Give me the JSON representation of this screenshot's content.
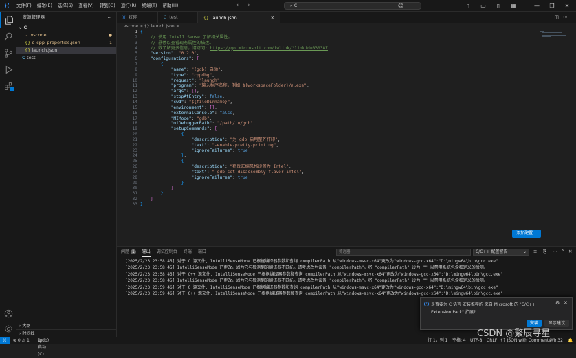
{
  "titlebar": {
    "menu": [
      "文件(F)",
      "编辑(E)",
      "选择(S)",
      "查看(V)",
      "转到(G)",
      "运行(R)",
      "终端(T)",
      "帮助(H)"
    ],
    "search": "C"
  },
  "activity": {
    "extensions_badge": "1"
  },
  "sidebar": {
    "title": "资源管理器",
    "more": "···",
    "root": "C",
    "folder": ".vscode",
    "files": [
      {
        "name": "c_cpp_properties.json",
        "status": "1"
      },
      {
        "name": "launch.json",
        "status": ""
      }
    ],
    "root_file": "test",
    "outline": "大纲",
    "timeline": "时间线"
  },
  "tabs": [
    {
      "label": "欢迎",
      "icon": "vscode-icon"
    },
    {
      "label": "test",
      "icon": "C"
    },
    {
      "label": "launch.json",
      "icon": "{}"
    }
  ],
  "breadcrumb": ".vscode > {} launch.json > ...",
  "code_lines": [
    {
      "n": "1",
      "t": "{"
    },
    {
      "n": "2",
      "t": "    // 使用 IntelliSense 了解相关属性。"
    },
    {
      "n": "3",
      "t": "    // 悬停以查看现有属性的描述。"
    },
    {
      "n": "4",
      "t": "    // 欲了解更多信息，请访问: https://go.microsoft.com/fwlink/?linkid=830387"
    },
    {
      "n": "5",
      "t": "    \"version\": \"0.2.0\","
    },
    {
      "n": "6",
      "t": "    \"configurations\": ["
    },
    {
      "n": "7",
      "t": "        {"
    },
    {
      "n": "8",
      "t": "            \"name\": \"(gdb) 启动\","
    },
    {
      "n": "9",
      "t": "            \"type\": \"cppdbg\","
    },
    {
      "n": "10",
      "t": "            \"request\": \"launch\","
    },
    {
      "n": "11",
      "t": "            \"program\": \"输入程序名称，例如 ${workspaceFolder}/a.exe\","
    },
    {
      "n": "12",
      "t": "            \"args\": [],"
    },
    {
      "n": "13",
      "t": "            \"stopAtEntry\": false,"
    },
    {
      "n": "14",
      "t": "            \"cwd\": \"${fileDirname}\","
    },
    {
      "n": "15",
      "t": "            \"environment\": [],"
    },
    {
      "n": "16",
      "t": "            \"externalConsole\": false,"
    },
    {
      "n": "17",
      "t": "            \"MIMode\": \"gdb\","
    },
    {
      "n": "18",
      "t": "            \"miDebuggerPath\": \"/path/to/gdb\","
    },
    {
      "n": "19",
      "t": "            \"setupCommands\": ["
    },
    {
      "n": "20",
      "t": "                {"
    },
    {
      "n": "21",
      "t": "                    \"description\": \"为 gdb 启用整齐打印\","
    },
    {
      "n": "22",
      "t": "                    \"text\": \"-enable-pretty-printing\","
    },
    {
      "n": "23",
      "t": "                    \"ignoreFailures\": true"
    },
    {
      "n": "24",
      "t": "                },"
    },
    {
      "n": "25",
      "t": "                {"
    },
    {
      "n": "26",
      "t": "                    \"description\": \"将反汇编风格设置为 Intel\","
    },
    {
      "n": "27",
      "t": "                    \"text\": \"-gdb-set disassembly-flavor intel\","
    },
    {
      "n": "28",
      "t": "                    \"ignoreFailures\": true"
    },
    {
      "n": "29",
      "t": "                }"
    },
    {
      "n": "30",
      "t": "            ]"
    },
    {
      "n": "31",
      "t": "        }"
    },
    {
      "n": "32",
      "t": "    ]"
    },
    {
      "n": "33",
      "t": "}"
    }
  ],
  "add_config_button": "添加配置...",
  "panel": {
    "tabs": [
      "问题",
      "输出",
      "调试控制台",
      "终端",
      "端口"
    ],
    "problems_badge": "1",
    "filter_placeholder": "筛选器",
    "channel": "C/C++ 配置警告",
    "lines": [
      "[2025/2/23 23:58:45] 对于 C 源文件, IntelliSenseMode 已根据编译器参数和查询 compilerPath 从\"windows-msvc-x64\"更改为\"windows-gcc-x64\":\"D:\\mingw64\\bin\\gcc.exe\"",
      "[2025/2/23 23:58:45] IntelliSenseMode 已更改，因为它与检测到的编译器不匹配。请考虑改为设置 \"compilerPath\"。将 \"compilerPath\" 设为 \"\" 以禁用系统包含和定义的检测。",
      "[2025/2/23 23:58:45] 对于 C++ 源文件, IntelliSenseMode 已根据编译器参数和查询 compilerPath 从\"windows-msvc-x64\"更改为\"windows-gcc-x64\":\"D:\\mingw64\\bin\\gcc.exe\"",
      "[2025/2/23 23:58:45] IntelliSenseMode 已更改，因为它与检测到的编译器不匹配。请考虑改为设置 \"compilerPath\"。将 \"compilerPath\" 设为 \"\" 以禁用系统包含和定义的检测。",
      "[2025/2/23 23:59:46] 对于 C 源文件, IntelliSenseMode 已根据编译器参数和查询 compilerPath 从\"windows-msvc-x64\"更改为\"windows-gcc-x64\":\"D:\\mingw64\\bin\\gcc.exe\"",
      "[2025/2/23 23:59:46] 对于 C++ 源文件, IntelliSenseMode 已根据编译器参数和查询 compilerPath 从\"windows-msvc-x64\"更改为\"windows-gcc-x64\":\"D:\\mingw64\\bin\\gcc.exe\""
    ]
  },
  "notification": {
    "message": "是否要为 C 语言 安装推荐的 来自 Microsoft 的 \"C/C++ Extension Pack\" 扩展?",
    "install": "安装",
    "show_recommendations": "显示建议"
  },
  "statusbar": {
    "problems": "⊗ 0 ⚠ 1",
    "debug": "(gdb) 启动 (C)",
    "cursor": "行 1，列 1",
    "spaces": "空格: 4",
    "encoding": "UTF-8",
    "eol": "CRLF",
    "language": "{} JSON with Comments",
    "platform": "Win32"
  },
  "watermark": "CSDN @繁辰寻星",
  "colors": {
    "accent": "#0078d4",
    "background": "#1f1f1f"
  }
}
